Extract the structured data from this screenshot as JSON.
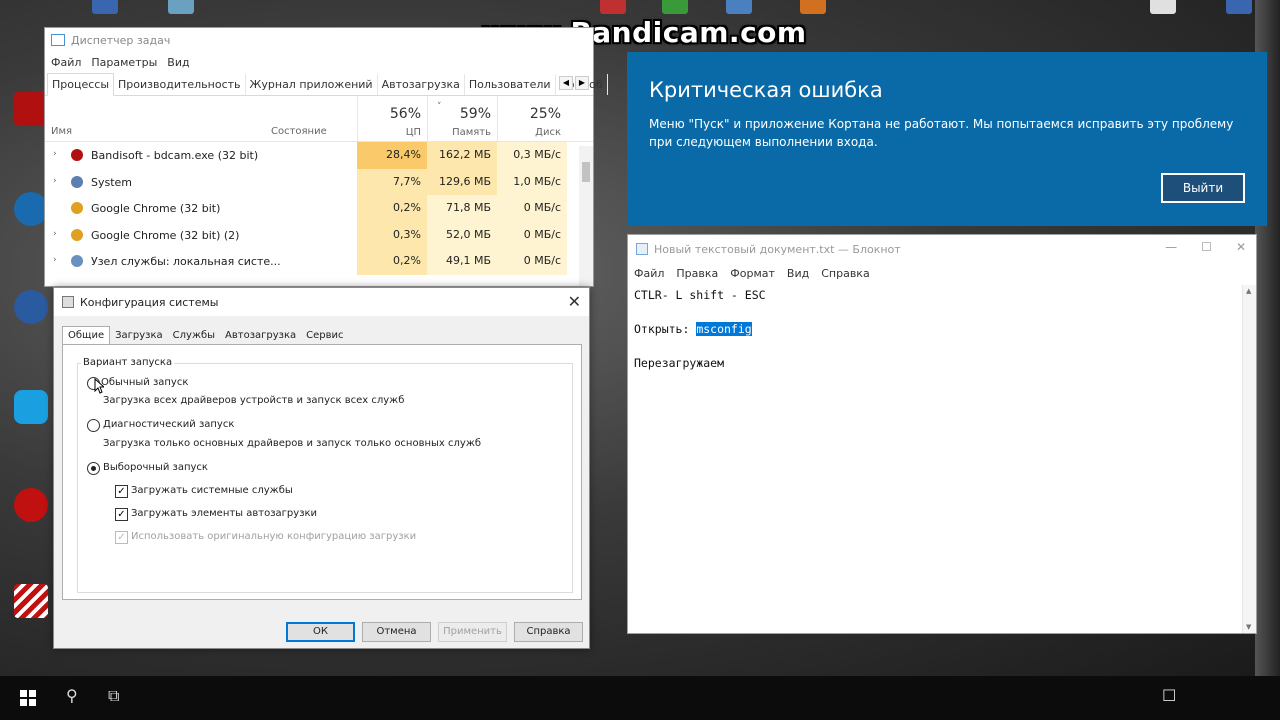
{
  "watermark": "www.Bandicam.com",
  "taskmgr": {
    "title": "Диспетчер задач",
    "menu": [
      "Файл",
      "Параметры",
      "Вид"
    ],
    "tabs": [
      "Процессы",
      "Производительность",
      "Журнал приложений",
      "Автозагрузка",
      "Пользователи",
      "Подроб"
    ],
    "columns": {
      "name": "Имя",
      "state": "Состояние",
      "cpu": {
        "pct": "56%",
        "label": "ЦП"
      },
      "mem": {
        "pct": "59%",
        "label": "Память"
      },
      "disk": {
        "pct": "25%",
        "label": "Диск"
      }
    },
    "rows": [
      {
        "name": "Bandisoft - bdcam.exe (32 bit)",
        "cpu": "28,4%",
        "mem": "162,2 МБ",
        "disk": "0,3 МБ/с",
        "expander": "›",
        "icon_color": "#b01010"
      },
      {
        "name": "System",
        "cpu": "7,7%",
        "mem": "129,6 МБ",
        "disk": "1,0 МБ/с",
        "expander": "›",
        "icon_color": "#5a7fb0"
      },
      {
        "name": "Google Chrome (32 bit)",
        "cpu": "0,2%",
        "mem": "71,8 МБ",
        "disk": "0 МБ/с",
        "expander": "",
        "icon_color": "#e0a020"
      },
      {
        "name": "Google Chrome (32 bit) (2)",
        "cpu": "0,3%",
        "mem": "52,0 МБ",
        "disk": "0 МБ/с",
        "expander": "›",
        "icon_color": "#e0a020"
      },
      {
        "name": "Узел службы: локальная систе...",
        "cpu": "0,2%",
        "mem": "49,1 МБ",
        "disk": "0 МБ/с",
        "expander": "›",
        "icon_color": "#6a90c0"
      }
    ]
  },
  "msconfig": {
    "title": "Конфигурация системы",
    "tabs": [
      "Общие",
      "Загрузка",
      "Службы",
      "Автозагрузка",
      "Сервис"
    ],
    "group_label": "Вариант запуска",
    "normal": {
      "label": "Обычный запуск",
      "desc": "Загрузка всех драйверов устройств и запуск всех служб"
    },
    "diagnostic": {
      "label": "Диагностический запуск",
      "desc": "Загрузка только основных драйверов и запуск только основных служб"
    },
    "selective": {
      "label": "Выборочный запуск"
    },
    "check_services": "Загружать системные службы",
    "check_startup": "Загружать элементы автозагрузки",
    "check_original": "Использовать оригинальную конфигурацию загрузки",
    "buttons": {
      "ok": "ОК",
      "cancel": "Отмена",
      "apply": "Применить",
      "help": "Справка"
    }
  },
  "crit": {
    "title": "Критическая ошибка",
    "message": "Меню \"Пуск\" и приложение Кортана не работают. Мы попытаемся исправить эту проблему при следующем выполнении входа.",
    "button": "Выйти"
  },
  "notepad": {
    "title": "Новый текстовый документ.txt — Блокнот",
    "menu": [
      "Файл",
      "Правка",
      "Формат",
      "Вид",
      "Справка"
    ],
    "line1": "CTLR- L shift - ESC",
    "line2_prefix": "Открыть: ",
    "line2_selected": "msconfig",
    "line3": "Перезагружаем"
  },
  "colors": {
    "crit_bg": "#0a6aa8",
    "heat_strong": "#f9c96a",
    "heat_mid": "#fde7ad",
    "heat_light": "#fff4d1",
    "selection": "#0078d7"
  }
}
